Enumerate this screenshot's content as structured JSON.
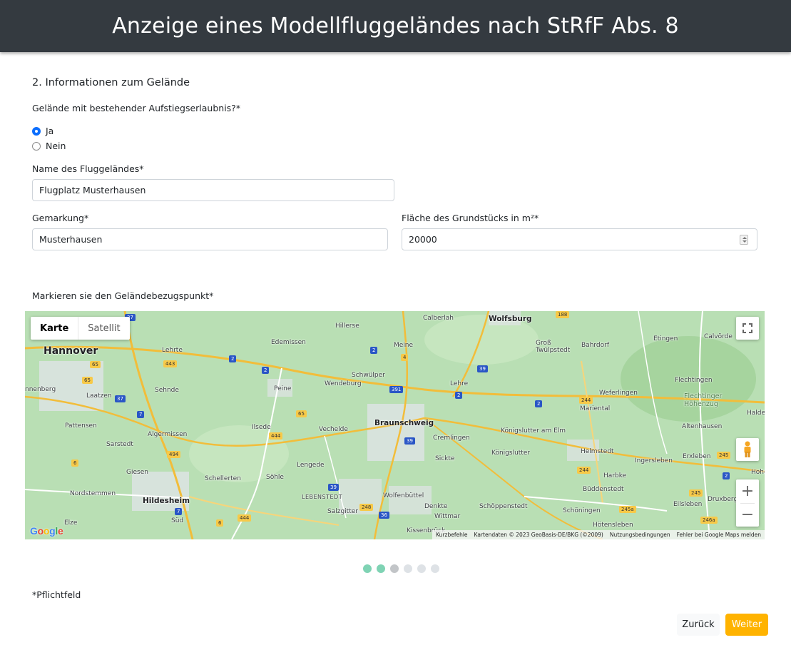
{
  "header": {
    "title": "Anzeige eines Modellfluggeländes nach StRfF Abs. 8"
  },
  "section": {
    "title": "2. Informationen zum Gelände"
  },
  "permission": {
    "question": "Gelände mit bestehender Aufstiegserlaubnis?*",
    "options": [
      {
        "label": "Ja",
        "checked": true
      },
      {
        "label": "Nein",
        "checked": false
      }
    ]
  },
  "fields": {
    "name": {
      "label": "Name des Fluggeländes*",
      "value": "Flugplatz Musterhausen"
    },
    "gemarkung": {
      "label": "Gemarkung*",
      "value": "Musterhausen"
    },
    "flaeche": {
      "label": "Fläche des Grundstücks in m²*",
      "value": "20000"
    }
  },
  "map": {
    "label": "Markieren sie den Geländebezugspunkt*",
    "type_tabs": [
      "Karte",
      "Satellit"
    ],
    "active_tab": "Karte",
    "places": {
      "hannover": "Hannover",
      "wolfsburg": "Wolfsburg",
      "braunschweig": "Braunschweig",
      "hildesheim": "Hildesheim",
      "hillerse": "Hillerse",
      "calberlah": "Calberlah",
      "edemissen": "Edemissen",
      "meine": "Meine",
      "lehrte": "Lehrte",
      "peine": "Peine",
      "sehnde": "Sehnde",
      "laatzen": "Laatzen",
      "wendeburg": "Wendeburg",
      "schwuelper": "Schwülper",
      "lehre": "Lehre",
      "pattensen": "Pattensen",
      "algermissen": "Algermissen",
      "ilsede": "Ilsede",
      "vechelde": "Vechelde",
      "cremlingen": "Cremlingen",
      "sarstedt": "Sarstedt",
      "giesen": "Giesen",
      "schellerten": "Schellerten",
      "soehle": "Söhle",
      "lengede": "Lengede",
      "sickte": "Sickte",
      "nordstemmen": "Nordstemmen",
      "lebenstedt": "LEBENSTEDT",
      "salzgitter": "Salzgitter",
      "wolfenbuettel": "Wolfenbüttel",
      "denkte": "Denkte",
      "wittmar": "Wittmar",
      "schoeppenstedt": "Schöppenstedt",
      "kissenbrueck": "Kissenbrück",
      "sued": "Süd",
      "elze": "Elze",
      "koenigslutter_am_elm": "Königslutter am Elm",
      "koenigslutter": "Königslutter",
      "helmstedt": "Helmstedt",
      "harbke": "Harbke",
      "ingersleben": "Ingersleben",
      "bueddenstedt": "Büddenstedt",
      "schoeningen": "Schöningen",
      "hoetensleben": "Hötensleben",
      "mariental": "Mariental",
      "weferlingen": "Weferlingen",
      "gross_twuelpstedt": "Groß Twülpstedt",
      "bahrdorf": "Bahrdorf",
      "etingen": "Etingen",
      "calvoerde": "Calvörde",
      "flechtingen": "Flechtingen",
      "flechtinger_hoehenzug": "Flechtinger Höhenzug",
      "altenhausen": "Altenhausen",
      "erxleben": "Erxleben",
      "eilsleben": "Eilsleben",
      "druxberge": "Druxberge",
      "ronnenberg": "nnenberg",
      "halde": "Halde",
      "hohe": "Hohe"
    },
    "road_shields": [
      "2",
      "2",
      "2",
      "2",
      "2",
      "2",
      "7",
      "7",
      "37",
      "37",
      "39",
      "39",
      "39",
      "391",
      "4",
      "65",
      "65",
      "65",
      "443",
      "444",
      "444",
      "494",
      "244",
      "244",
      "245",
      "245",
      "245a",
      "246a",
      "248",
      "36",
      "188",
      "6",
      "6"
    ],
    "attribution": [
      "Kurzbefehle",
      "Kartendaten © 2023 GeoBasis-DE/BKG (©2009)",
      "Nutzungsbedingungen",
      "Fehler bei Google Maps melden"
    ],
    "google_logo": "Google",
    "icons": [
      "fullscreen-icon",
      "pegman-icon",
      "zoom-in-icon",
      "zoom-out-icon"
    ]
  },
  "progress": {
    "total_steps": 6,
    "current_step": 3,
    "done_color": "#7fd3b4",
    "pending_color": "#dee2e6"
  },
  "footer": {
    "required_note": "*Pflichtfeld"
  },
  "buttons": {
    "back": "Zurück",
    "next": "Weiter",
    "next_color": "#ffb300"
  }
}
